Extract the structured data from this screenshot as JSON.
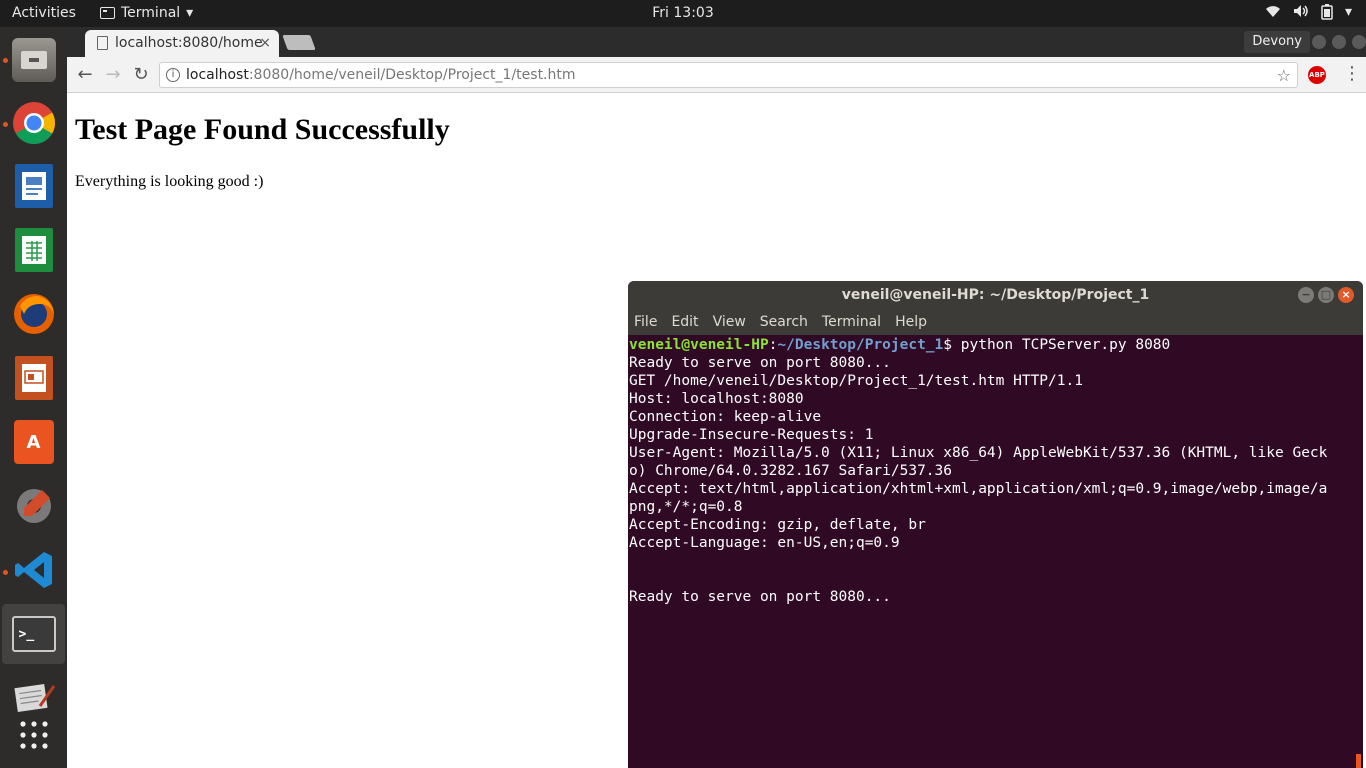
{
  "topbar": {
    "activities": "Activities",
    "app_menu": "Terminal",
    "clock": "Fri 13:03"
  },
  "dock": {
    "apps": [
      "files",
      "chrome",
      "writer",
      "calc",
      "firefox",
      "impress",
      "software",
      "settings",
      "vscode",
      "terminal",
      "text-editor",
      "show-apps"
    ]
  },
  "browser": {
    "tab_title": "localhost:8080/home",
    "tab_close": "×",
    "profile": "Devony",
    "url_host": "localhost",
    "url_rest": ":8080/home/veneil/Desktop/Project_1/test.htm",
    "page_heading": "Test Page Found Successfully",
    "page_text": "Everything is looking good :)",
    "abp": "ABP"
  },
  "terminal": {
    "title": "veneil@veneil-HP: ~/Desktop/Project_1",
    "menu": [
      "File",
      "Edit",
      "View",
      "Search",
      "Terminal",
      "Help"
    ],
    "prompt_user": "veneil@veneil-HP",
    "prompt_sep": ":",
    "prompt_path": "~/Desktop/Project_1",
    "prompt_cmd": "$ python TCPServer.py 8080",
    "lines": [
      "Ready to serve on port 8080...",
      "GET /home/veneil/Desktop/Project_1/test.htm HTTP/1.1",
      "Host: localhost:8080",
      "Connection: keep-alive",
      "Upgrade-Insecure-Requests: 1",
      "User-Agent: Mozilla/5.0 (X11; Linux x86_64) AppleWebKit/537.36 (KHTML, like Geck",
      "o) Chrome/64.0.3282.167 Safari/537.36",
      "Accept: text/html,application/xhtml+xml,application/xml;q=0.9,image/webp,image/a",
      "png,*/*;q=0.8",
      "Accept-Encoding: gzip, deflate, br",
      "Accept-Language: en-US,en;q=0.9",
      "",
      "",
      "Ready to serve on port 8080..."
    ]
  },
  "colors": {
    "accent": "#e95420",
    "terminal_bg": "#300a24",
    "prompt_user": "#8ae234",
    "prompt_path": "#729fcf"
  }
}
